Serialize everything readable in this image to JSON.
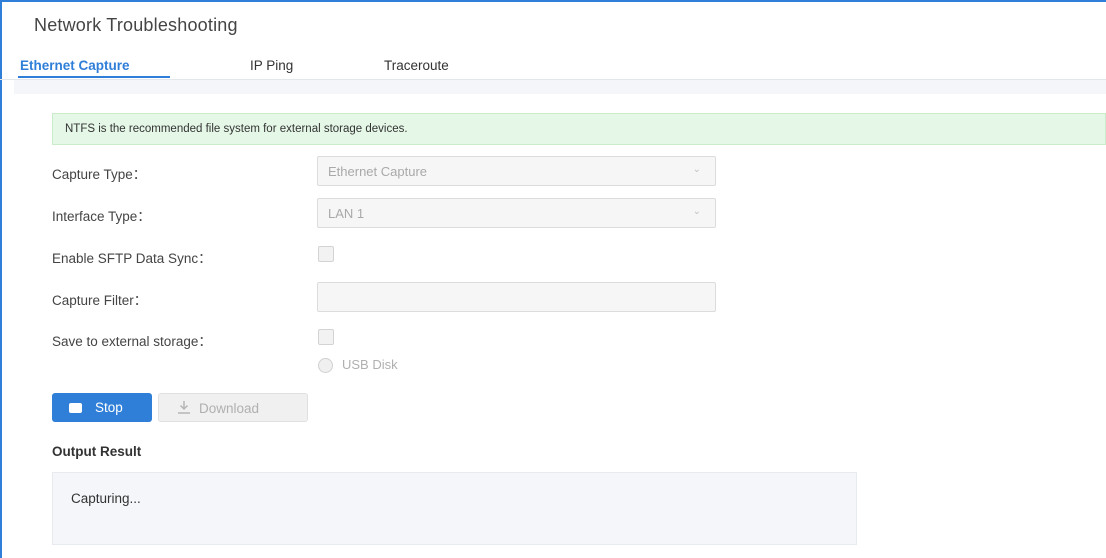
{
  "page": {
    "title": "Network Troubleshooting"
  },
  "tabs": [
    {
      "label": "Ethernet Capture",
      "active": true
    },
    {
      "label": "IP Ping",
      "active": false
    },
    {
      "label": "Traceroute",
      "active": false
    }
  ],
  "notice": "NTFS is the recommended file system for external storage devices.",
  "form": {
    "capture_type": {
      "label": "Capture Type：",
      "value": "Ethernet Capture"
    },
    "interface_type": {
      "label": "Interface Type：",
      "value": "LAN 1"
    },
    "sftp_sync": {
      "label": "Enable SFTP Data Sync：",
      "checked": false
    },
    "capture_filter": {
      "label": "Capture Filter：",
      "value": ""
    },
    "external_storage": {
      "label": "Save to external storage：",
      "checked": false
    },
    "usb_disk": {
      "label": "USB Disk",
      "selected": false
    }
  },
  "buttons": {
    "stop": "Stop",
    "download": "Download"
  },
  "output": {
    "title": "Output Result",
    "text": "Capturing..."
  },
  "colors": {
    "accent": "#2f7fd8",
    "notice_bg": "#e5f7e6"
  },
  "icons": {
    "stop": "stop-square-icon",
    "download": "download-icon",
    "select": "chevron-down-icon"
  }
}
